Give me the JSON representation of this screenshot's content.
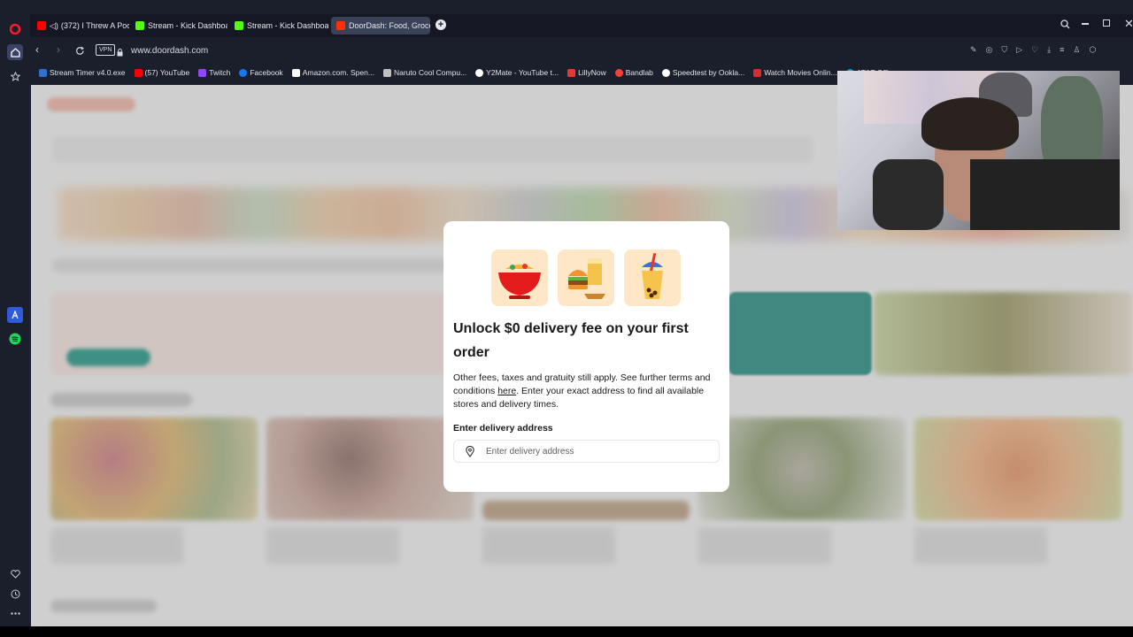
{
  "browser": {
    "tabs": [
      {
        "label": "(372) I Threw A Pool P",
        "color": "#ff0000",
        "active": false
      },
      {
        "label": "Stream - Kick Dashboard",
        "color": "#53fc18",
        "active": false
      },
      {
        "label": "Stream - Kick Dashboard",
        "color": "#53fc18",
        "active": false
      },
      {
        "label": "DoorDash: Food, Grocery",
        "color": "#ff3008",
        "active": true
      }
    ],
    "vpn_badge": "VPN",
    "url": "www.doordash.com",
    "bookmarks": [
      {
        "label": "Stream Timer v4.0.exe",
        "color": "#2f6fd0"
      },
      {
        "label": "(57) YouTube",
        "color": "#ff0000"
      },
      {
        "label": "Twitch",
        "color": "#9146ff"
      },
      {
        "label": "Facebook",
        "color": "#1877f2"
      },
      {
        "label": "Amazon.com. Spen...",
        "color": "#ffffff"
      },
      {
        "label": "Naruto Cool Compu...",
        "color": "#c0c0c0"
      },
      {
        "label": "Y2Mate - YouTube t...",
        "color": "#ffffff"
      },
      {
        "label": "LillyNow",
        "color": "#e53935"
      },
      {
        "label": "Bandlab",
        "color": "#f44336"
      },
      {
        "label": "Speedtest by Ookla...",
        "color": "#ffffff"
      },
      {
        "label": "Watch Movies Onlin...",
        "color": "#d32f2f"
      },
      {
        "label": "AT&T Offic...",
        "color": "#00a8e0"
      }
    ]
  },
  "modal": {
    "title": "Unlock $0 delivery fee on your first order",
    "body_before_link": "Other fees, taxes and gratuity still apply. See further terms and conditions ",
    "body_link": "here",
    "body_after_link": ". Enter your exact address to find all available stores and delivery times.",
    "address_label": "Enter delivery address",
    "address_placeholder": "Enter delivery address",
    "address_value": "",
    "tile_icons": [
      "noodle-bowl-icon",
      "burger-drink-icon",
      "bubble-tea-icon"
    ]
  },
  "colors": {
    "accent": "#ff3008",
    "tile_bg": "#fde7c6",
    "browser_bg": "#1b1e2b"
  }
}
